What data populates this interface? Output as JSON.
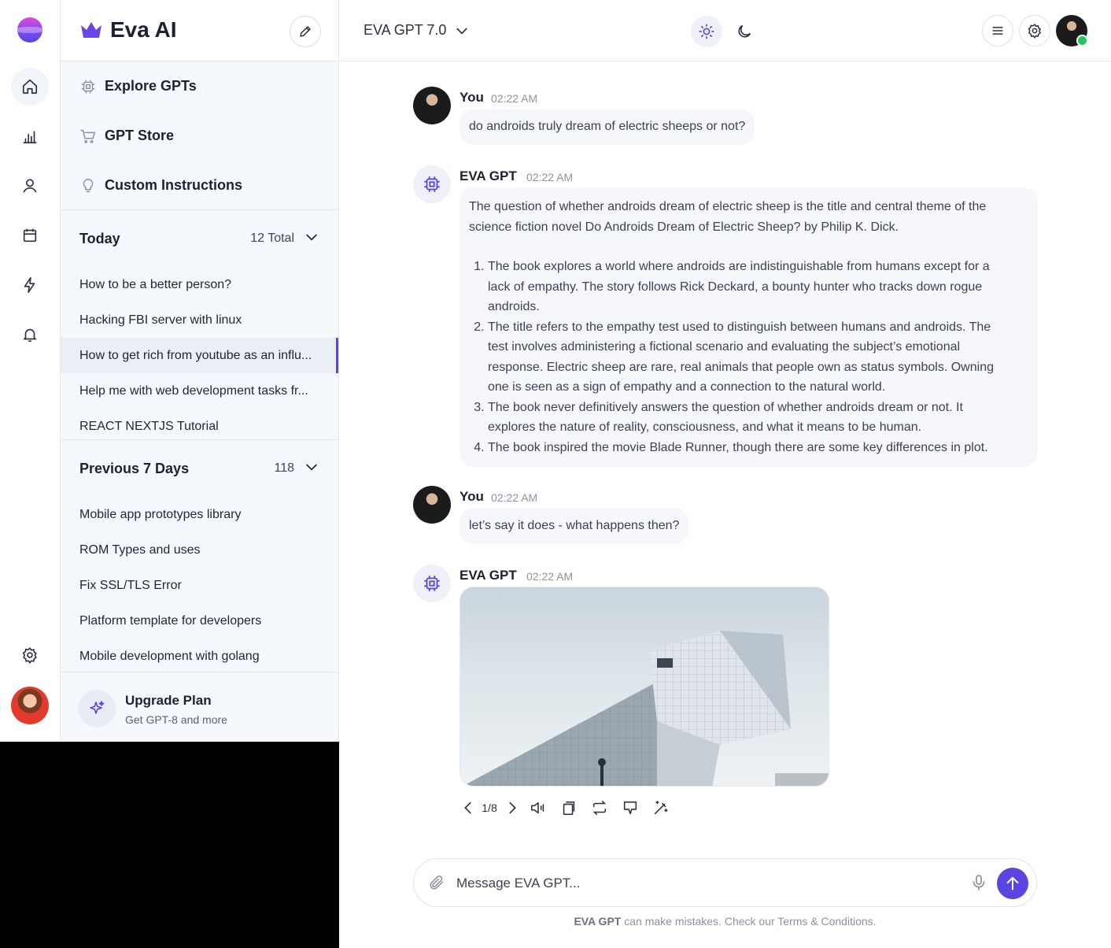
{
  "app": {
    "brand": "Eva AI",
    "model": "EVA GPT 7.0"
  },
  "rail": {
    "icons": [
      "home-icon",
      "chart-icon",
      "user-icon",
      "calendar-icon",
      "lightning-icon",
      "bell-icon",
      "gear-icon"
    ]
  },
  "nav": {
    "explore": "Explore GPTs",
    "store": "GPT Store",
    "custom": "Custom Instructions"
  },
  "today": {
    "title": "Today",
    "count": "12 Total",
    "items": [
      "How to be a better person?",
      "Hacking FBI server with linux",
      "How to get rich from youtube as an influ...",
      "Help me with web development tasks fr...",
      "REACT NEXTJS Tutorial"
    ]
  },
  "previous": {
    "title": "Previous 7 Days",
    "count": "118",
    "items": [
      "Mobile app prototypes library",
      "ROM Types and uses",
      "Fix SSL/TLS Error",
      "Platform template for developers",
      "Mobile development with golang"
    ]
  },
  "upgrade": {
    "title": "Upgrade Plan",
    "subtitle": "Get GPT-8 and more"
  },
  "messages": [
    {
      "author": "You",
      "time": "02:22 AM",
      "text": "do androids truly dream of electric sheeps or not?"
    },
    {
      "author": "EVA GPT",
      "time": "02:22 AM",
      "intro": "The question of whether androids dream of electric sheep is the title and central theme of the science fiction novel  Do Androids Dream of Electric Sheep? by Philip K. Dick.",
      "points": [
        "The book explores a world where androids are indistinguishable from humans except for a lack of empathy. The story follows Rick Deckard, a bounty hunter who tracks down rogue androids.",
        "The title refers to the  empathy test used to distinguish between humans and androids. The test involves administering a fictional scenario and evaluating the subject’s emotional response. Electric sheep are rare, real animals that people own as status symbols. Owning one is seen as a sign of empathy and a connection to the natural world.",
        "The book never definitively answers the question of whether androids dream or not. It explores the nature of reality, consciousness, and what it means to be human.",
        "The book inspired the movie Blade Runner, though there are some key differences in plot."
      ]
    },
    {
      "author": "You",
      "time": "02:22 AM",
      "text": "let’s say it does - what happens then?"
    },
    {
      "author": "EVA GPT",
      "time": "02:22 AM",
      "pager": "1/8"
    }
  ],
  "composer": {
    "placeholder": "Message EVA GPT...",
    "disclaimer_brand": "EVA GPT",
    "disclaimer_rest": " can make mistakes. Check our Terms & Conditions."
  },
  "colors": {
    "accent": "#5b45e0",
    "online": "#22c55e"
  }
}
